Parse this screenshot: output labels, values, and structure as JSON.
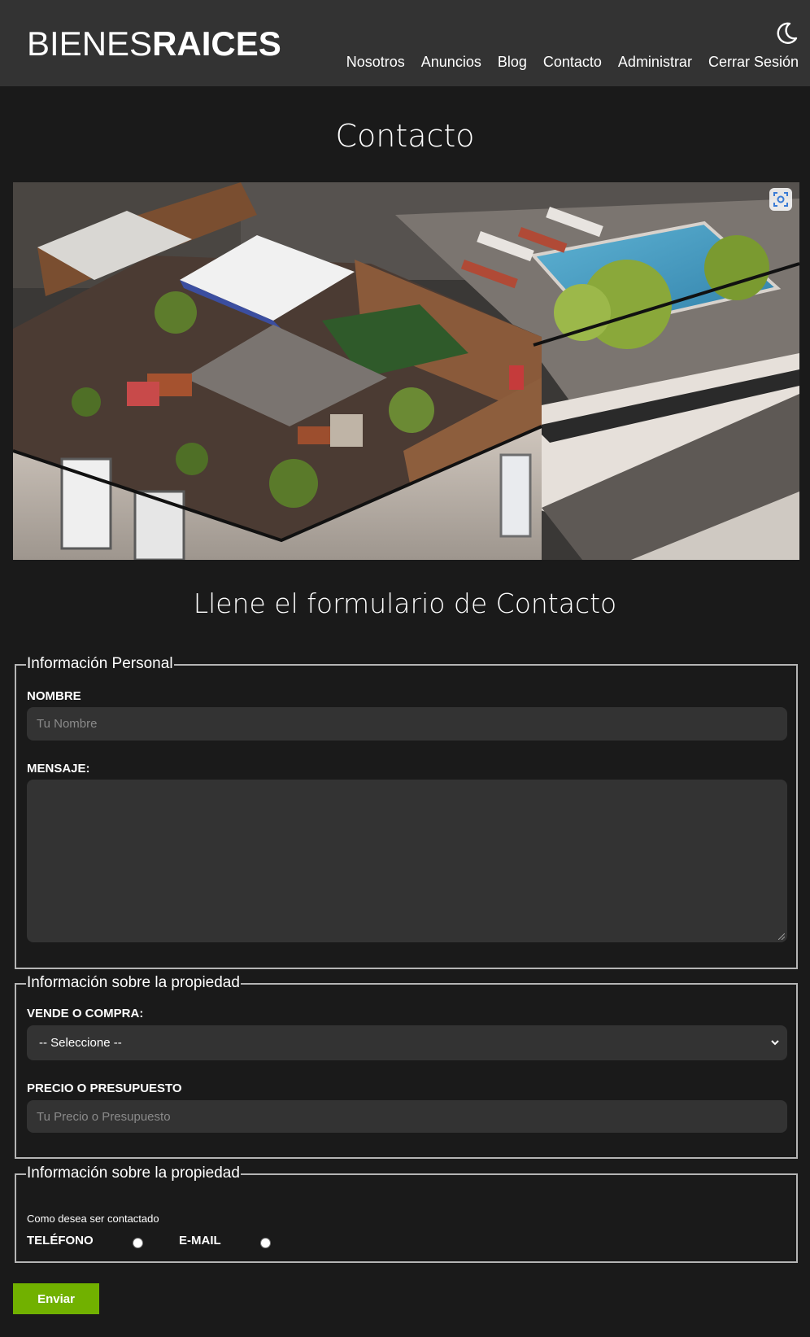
{
  "header": {
    "logo_light": "BIENES",
    "logo_bold": "RAICES",
    "nav": [
      "Nosotros",
      "Anuncios",
      "Blog",
      "Contacto",
      "Administrar",
      "Cerrar Sesión"
    ],
    "theme_icon": "moon-icon"
  },
  "main": {
    "title": "Contacto",
    "subtitle": "Llene el formulario de Contacto",
    "hero_lens_icon": "lens-icon"
  },
  "personal": {
    "legend": "Información Personal",
    "name_label": "NOMBRE",
    "name_placeholder": "Tu Nombre",
    "message_label": "MENSAJE:",
    "message_value": ""
  },
  "property": {
    "legend": "Información sobre la propiedad",
    "type_label": "VENDE O COMPRA:",
    "type_selected": "-- Seleccione --",
    "price_label": "PRECIO O PRESUPUESTO",
    "price_placeholder": "Tu Precio o Presupuesto"
  },
  "contact": {
    "legend": "Información sobre la propiedad",
    "question": "Como desea ser contactado",
    "phone_label": "TELÉFONO",
    "email_label": "E-MAIL"
  },
  "submit_label": "Enviar",
  "colors": {
    "background": "#1a1a1a",
    "header": "#333333",
    "accent_button": "#71b100",
    "field": "#333333"
  }
}
